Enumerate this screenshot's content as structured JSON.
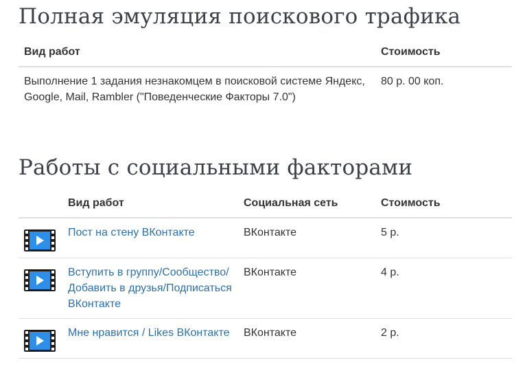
{
  "section1": {
    "title": "Полная эмуляция поискового трафика",
    "headers": {
      "work": "Вид работ",
      "price": "Стоимость"
    },
    "rows": [
      {
        "work": "Выполнение 1 задания незнакомцем в поисковой системе Яндекс, Google, Mail, Rambler (\"Поведенческие Факторы 7.0\")",
        "price": "80 р. 00 коп."
      }
    ]
  },
  "section2": {
    "title": "Работы с социальными факторами",
    "headers": {
      "work": "Вид работ",
      "network": "Социальная сеть",
      "price": "Стоимость"
    },
    "rows": [
      {
        "icon": "video-icon",
        "work": "Пост на стену ВКонтакте",
        "network": "ВКонтакте",
        "price": "5 р."
      },
      {
        "icon": "video-icon",
        "work": "Вступить в группу/Сообщество/Добавить в друзья/Подписаться ВКонтакте",
        "network": "ВКонтакте",
        "price": "4 р."
      },
      {
        "icon": "video-icon",
        "work": "Мне нравится / Likes ВКонтакте",
        "network": "ВКонтакте",
        "price": "2 р."
      }
    ]
  },
  "colors": {
    "link": "#2e6fa7",
    "title": "#3d4047",
    "icon_blue": "#2f8fe6",
    "divider": "#dddddd"
  }
}
